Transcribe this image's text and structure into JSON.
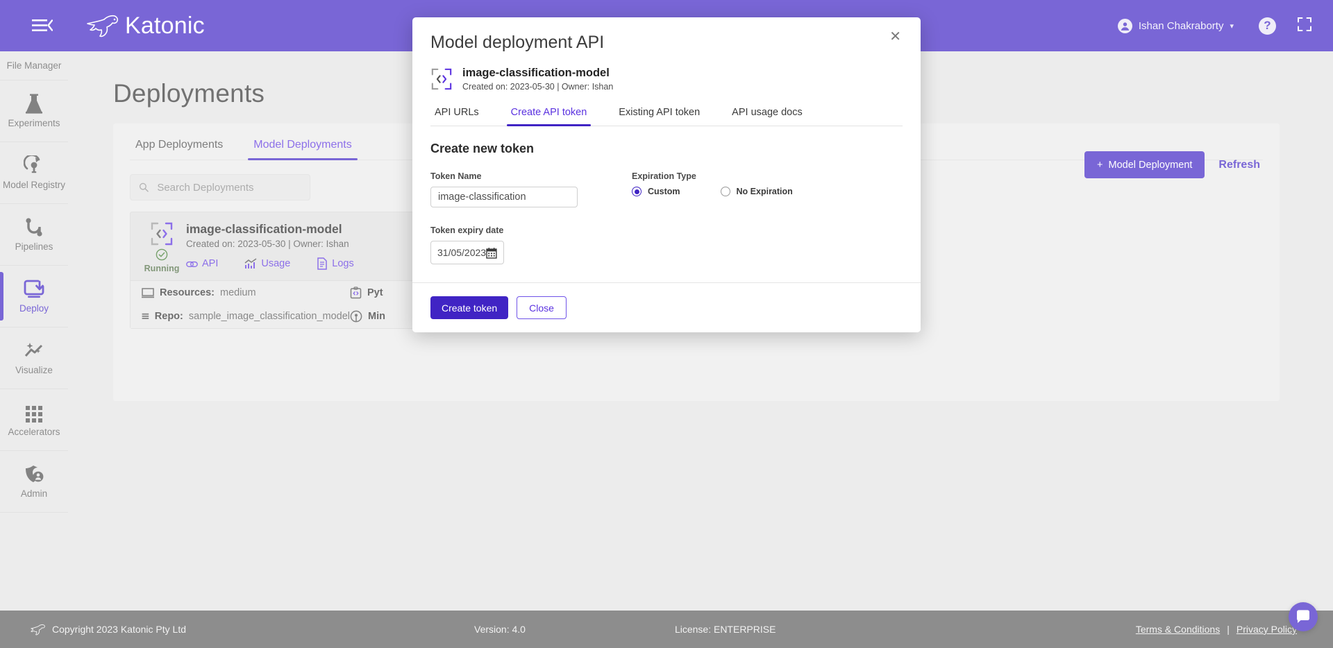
{
  "brand": {
    "name": "Katonic",
    "logo_icon": "kangaroo-logo-icon",
    "menu_icon": "hamburger-collapse-icon"
  },
  "topbar": {
    "user_name": "Ishan Chakraborty",
    "user_icon": "account-circle-icon",
    "chevron": "∨",
    "help_label": "?",
    "help_icon": "help-circle-icon",
    "fullscreen_icon": "fullscreen-icon",
    "accent": "#4024c4"
  },
  "sidebar": {
    "items": [
      {
        "label": "File Manager",
        "icon": "folder-icon",
        "active": false
      },
      {
        "label": "Experiments",
        "icon": "flask-icon",
        "active": false
      },
      {
        "label": "Model Registry",
        "icon": "model-registry-icon",
        "active": false
      },
      {
        "label": "Pipelines",
        "icon": "pipelines-icon",
        "active": false
      },
      {
        "label": "Deploy",
        "icon": "deploy-download-icon",
        "active": true
      },
      {
        "label": "Visualize",
        "icon": "visualize-sparkle-icon",
        "active": false
      },
      {
        "label": "Accelerators",
        "icon": "grid-apps-icon",
        "active": false
      },
      {
        "label": "Admin",
        "icon": "shield-user-icon",
        "active": false
      }
    ]
  },
  "page": {
    "title": "Deployments",
    "tabs": [
      {
        "label": "App Deployments",
        "active": false
      },
      {
        "label": "Model Deployments",
        "active": true
      }
    ],
    "actions": {
      "new_deployment_label": "Model Deployment",
      "new_deployment_icon": "plus-icon",
      "refresh_label": "Refresh"
    },
    "search": {
      "placeholder": "Search Deployments",
      "value": "",
      "icon": "search-icon"
    },
    "deployment_card": {
      "icon": "code-brackets-icon",
      "status": "Running",
      "status_icon": "check-circle-icon",
      "title": "image-classification-model",
      "subtitle": "Created on: 2023-05-30 | Owner: Ishan",
      "links": [
        {
          "label": "API",
          "icon": "link-chain-icon"
        },
        {
          "label": "Usage",
          "icon": "chart-usage-icon"
        },
        {
          "label": "Logs",
          "icon": "document-logs-icon"
        }
      ],
      "rows": [
        {
          "key": "Resources:",
          "value": "medium",
          "icon": "monitor-icon",
          "key2": "Pyt",
          "value2": "",
          "icon2": "code-clipboard-icon"
        },
        {
          "key": "Repo:",
          "value": "sample_image_classification_model",
          "icon": "layers-repo-icon",
          "key2": "Min",
          "value2": "",
          "icon2": "broadcast-icon"
        }
      ]
    }
  },
  "modal": {
    "title": "Model deployment API",
    "close_icon": "close-icon",
    "model": {
      "icon": "code-brackets-icon",
      "name": "image-classification-model",
      "meta": "Created on: 2023-05-30 | Owner: Ishan"
    },
    "tabs": [
      {
        "label": "API URLs",
        "active": false
      },
      {
        "label": "Create API token",
        "active": true
      },
      {
        "label": "Existing API token",
        "active": false
      },
      {
        "label": "API usage docs",
        "active": false
      }
    ],
    "section_title": "Create new token",
    "token_name": {
      "label": "Token Name",
      "value": "image-classification",
      "placeholder": "Token Name"
    },
    "expiration": {
      "label": "Expiration Type",
      "options": [
        {
          "label": "Custom",
          "selected": true
        },
        {
          "label": "No Expiration",
          "selected": false
        }
      ]
    },
    "expiry": {
      "label": "Token expiry date",
      "value": "31/05/2023",
      "icon": "calendar-icon"
    },
    "buttons": {
      "create_label": "Create token",
      "close_label": "Close"
    }
  },
  "footer": {
    "copyright": "Copyright 2023 Katonic Pty Ltd",
    "logo_icon": "kangaroo-logo-icon",
    "version": "Version: 4.0",
    "license": "License: ENTERPRISE",
    "terms": "Terms & Conditions",
    "separator": "|",
    "privacy": "Privacy Policy"
  },
  "chat": {
    "icon": "chat-bubble-icon"
  }
}
